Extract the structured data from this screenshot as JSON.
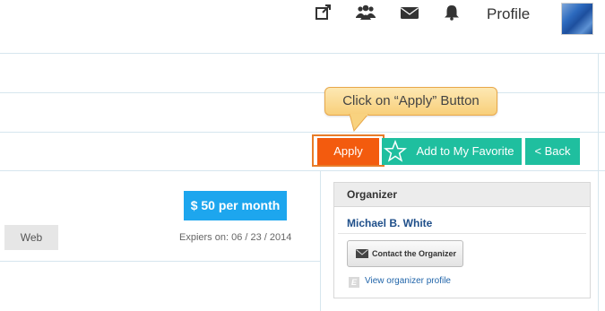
{
  "header": {
    "icons": [
      "external-link-icon",
      "users-icon",
      "mail-icon",
      "bell-icon"
    ],
    "profile_label": "Profile"
  },
  "callout": {
    "text": "Click on “Apply” Button",
    "fill_color": "#f9d889",
    "border_color": "#e8a84a"
  },
  "actions": {
    "apply_label": "Apply",
    "favorite_label": "Add to My Favorite",
    "back_label": "< Back",
    "apply_color": "#f35b0e",
    "secondary_color": "#1fbf9f"
  },
  "listing": {
    "price": "$ 50 per month",
    "expires": "Expiers on: 06 / 23 / 2014",
    "tag": "Web",
    "price_color": "#1da6ee"
  },
  "organizer": {
    "title": "Organizer",
    "name": "Michael B. White",
    "contact_label": "Contact the Organizer",
    "profile_link": "View organizer profile",
    "badge": "E"
  }
}
